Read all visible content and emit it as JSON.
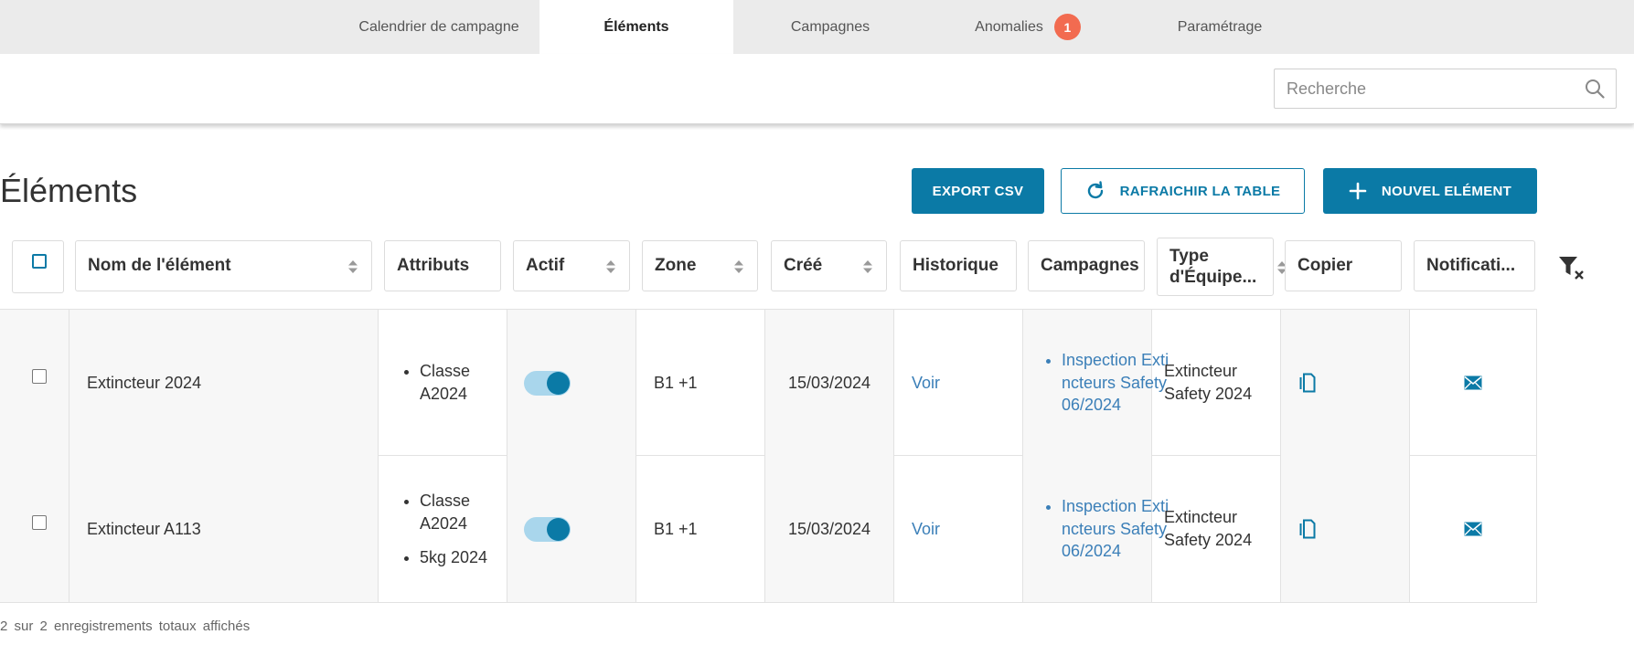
{
  "nav": {
    "tabs": [
      {
        "label": "Calendrier de campagne"
      },
      {
        "label": "Éléments"
      },
      {
        "label": "Campagnes"
      },
      {
        "label": "Anomalies",
        "badge": "1"
      },
      {
        "label": "Paramétrage"
      }
    ],
    "active_tab": "Éléments"
  },
  "search": {
    "placeholder": "Recherche",
    "value": ""
  },
  "page": {
    "title": "Éléments"
  },
  "toolbar": {
    "export_label": "EXPORT CSV",
    "refresh_label": "RAFRAICHIR LA TABLE",
    "new_label": "NOUVEL ELÉMENT"
  },
  "table": {
    "columns": [
      "Nom de l'élément",
      "Attributs",
      "Actif",
      "Zone",
      "Créé",
      "Historique",
      "Campagnes",
      "Type d'Équipe...",
      "Copier",
      "Notificati..."
    ],
    "rows": [
      {
        "name": "Extincteur 2024",
        "attributes": [
          "Classe A2024"
        ],
        "active": true,
        "zone": "B1 +1",
        "created": "15/03/2024",
        "history": "Voir",
        "campaigns": [
          "Inspection Extincteurs Safety 06/2024"
        ],
        "type": "Extincteur Safety 2024"
      },
      {
        "name": "Extincteur A113",
        "attributes": [
          "Classe A2024",
          "5kg 2024"
        ],
        "active": true,
        "zone": "B1 +1",
        "created": "15/03/2024",
        "history": "Voir",
        "campaigns": [
          "Inspection Extincteurs Safety 06/2024"
        ],
        "type": "Extincteur Safety 2024"
      }
    ]
  },
  "footer": {
    "summary": "2 sur 2 enregistrements totaux affichés"
  },
  "colors": {
    "accent": "#0b7aa6",
    "badge": "#f26b50",
    "link": "#3b7fb8"
  },
  "icons": [
    "search-icon",
    "refresh-icon",
    "plus-icon",
    "sort-icon",
    "filter-clear-icon",
    "copy-icon",
    "mail-icon"
  ]
}
